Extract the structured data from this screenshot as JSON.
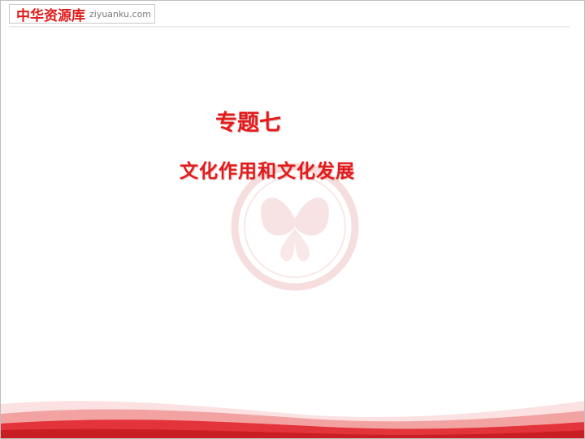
{
  "logo": {
    "name_cn": "中华资源库",
    "domain": "ziyuanku.com"
  },
  "slide": {
    "title": "专题七",
    "subtitle": "文化作用和文化发展"
  },
  "colors": {
    "title_red": "#e41a1a",
    "logo_red": "#e01a1a",
    "wave_red": "#e2343a",
    "wave_pink": "#f3a2a2"
  },
  "icons": {
    "watermark": "butterfly-seal-icon"
  }
}
